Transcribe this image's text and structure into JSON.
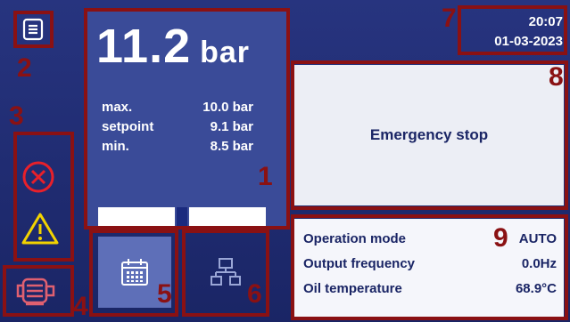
{
  "menu": {
    "icon": "menu-icon"
  },
  "pressure": {
    "value": "11.2",
    "unit": "bar",
    "rows": [
      {
        "label": "max.",
        "value": "10.0 bar"
      },
      {
        "label": "setpoint",
        "value": "9.1 bar"
      },
      {
        "label": "min.",
        "value": "8.5 bar"
      }
    ]
  },
  "datetime": {
    "time": "20:07",
    "date": "01-03-2023"
  },
  "emergency": {
    "label": "Emergency stop"
  },
  "info": {
    "rows": [
      {
        "label": "Operation mode",
        "value": "AUTO"
      },
      {
        "label": "Output frequency",
        "value": "0.0Hz"
      },
      {
        "label": "Oil temperature",
        "value": "68.9°C"
      }
    ]
  },
  "markers": [
    "1",
    "2",
    "3",
    "4",
    "5",
    "6",
    "7",
    "8",
    "9"
  ],
  "colors": {
    "frame": "#8a1113",
    "error": "#e8202a",
    "warning": "#f2d300",
    "motor": "#e06070",
    "background": "#27347f",
    "panel": "#3a4b98"
  }
}
